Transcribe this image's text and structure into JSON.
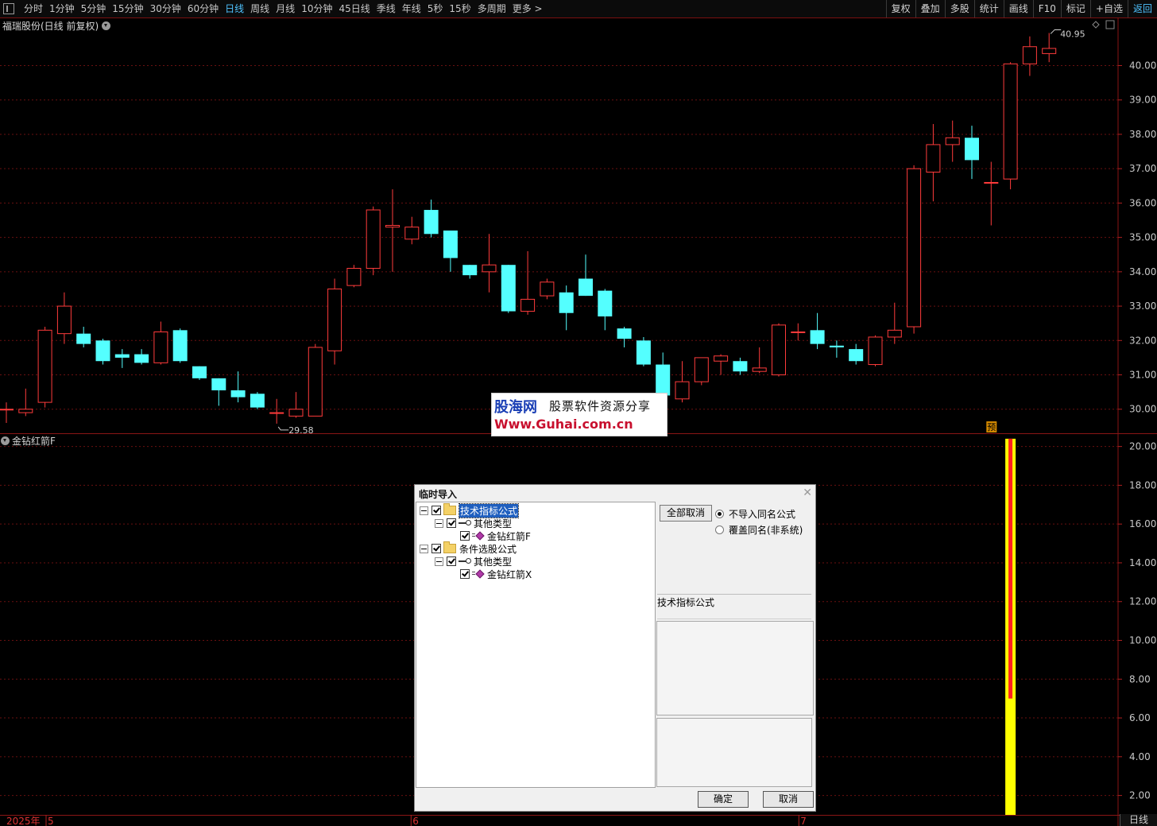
{
  "toolbar": {
    "periods": [
      {
        "label": "分时",
        "active": false
      },
      {
        "label": "1分钟",
        "active": false
      },
      {
        "label": "5分钟",
        "active": false
      },
      {
        "label": "15分钟",
        "active": false
      },
      {
        "label": "30分钟",
        "active": false
      },
      {
        "label": "60分钟",
        "active": false
      },
      {
        "label": "日线",
        "active": true
      },
      {
        "label": "周线",
        "active": false
      },
      {
        "label": "月线",
        "active": false
      },
      {
        "label": "10分钟",
        "active": false
      },
      {
        "label": "45日线",
        "active": false
      },
      {
        "label": "季线",
        "active": false
      },
      {
        "label": "年线",
        "active": false
      },
      {
        "label": "5秒",
        "active": false
      },
      {
        "label": "15秒",
        "active": false
      },
      {
        "label": "多周期",
        "active": false
      },
      {
        "label": "更多 >",
        "active": false
      }
    ],
    "right_buttons": [
      {
        "label": "复权",
        "highlight": false
      },
      {
        "label": "叠加",
        "highlight": false
      },
      {
        "label": "多股",
        "highlight": false
      },
      {
        "label": "统计",
        "highlight": false
      },
      {
        "label": "画线",
        "highlight": false
      },
      {
        "label": "F10",
        "highlight": false
      },
      {
        "label": "标记",
        "highlight": false
      },
      {
        "label": "+自选",
        "highlight": false
      },
      {
        "label": "返回",
        "highlight": true
      }
    ]
  },
  "main_panel": {
    "title": "福瑞股份(日线 前复权)",
    "price_labels": [
      "40.00",
      "39.00",
      "38.00",
      "37.00",
      "36.00",
      "35.00",
      "34.00",
      "33.00",
      "32.00",
      "31.00",
      "30.00"
    ],
    "high_label": "40.95",
    "low_label": "29.58",
    "forecast_badge": "预",
    "colors": {
      "up": "#ff3b3b",
      "down": "#54ffff",
      "grid": "#6a1010"
    }
  },
  "indicator_panel": {
    "title": "金钻红箭F",
    "axis_labels": [
      "20.00",
      "18.00",
      "16.00",
      "14.00",
      "12.00",
      "10.00",
      "8.00",
      "6.00",
      "4.00",
      "2.00"
    ],
    "bar_colors": {
      "yellow": "#ffff00",
      "red": "#ff2020"
    }
  },
  "bottom_axis": {
    "labels": [
      {
        "text": "2025年",
        "month": "5"
      },
      {
        "text": "6"
      },
      {
        "text": "7"
      }
    ],
    "tab_label": "日线"
  },
  "watermark": {
    "logo": "股海网",
    "subtitle": "股票软件资源分享",
    "url": "Www.Guhai.com.cn"
  },
  "dialog": {
    "title": "临时导入",
    "tree": [
      {
        "level": 0,
        "icon": "folder-icon",
        "label": "技术指标公式",
        "checked": true,
        "selected": true
      },
      {
        "level": 1,
        "icon": "key-icon",
        "label": "其他类型",
        "checked": true
      },
      {
        "level": 2,
        "icon": "formula-icon",
        "label": "金钻红箭F",
        "checked": true
      },
      {
        "level": 0,
        "icon": "folder-icon",
        "label": "条件选股公式",
        "checked": true
      },
      {
        "level": 1,
        "icon": "key-icon",
        "label": "其他类型",
        "checked": true
      },
      {
        "level": 2,
        "icon": "formula-icon",
        "label": "金钻红箭X",
        "checked": true
      }
    ],
    "cancel_all_label": "全部取消",
    "radio_options": [
      {
        "label": "不导入同名公式",
        "checked": true
      },
      {
        "label": "覆盖同名(非系统)",
        "checked": false
      }
    ],
    "info_label": "技术指标公式",
    "ok_label": "确定",
    "cancel_label": "取消"
  },
  "chart_data": {
    "type": "candlestick",
    "title": "福瑞股份(日线 前复权)",
    "ylim": [
      29.3,
      41.4
    ],
    "candles": [
      {
        "o": 30.0,
        "h": 30.2,
        "l": 29.6,
        "c": 30.0
      },
      {
        "o": 29.9,
        "h": 30.6,
        "l": 29.8,
        "c": 30.0
      },
      {
        "o": 30.2,
        "h": 32.4,
        "l": 30.05,
        "c": 32.3
      },
      {
        "o": 32.2,
        "h": 33.4,
        "l": 31.9,
        "c": 33.0
      },
      {
        "o": 32.2,
        "h": 32.4,
        "l": 31.8,
        "c": 31.9
      },
      {
        "o": 32.0,
        "h": 32.05,
        "l": 31.3,
        "c": 31.4
      },
      {
        "o": 31.6,
        "h": 31.75,
        "l": 31.2,
        "c": 31.5
      },
      {
        "o": 31.6,
        "h": 31.75,
        "l": 31.3,
        "c": 31.35
      },
      {
        "o": 31.35,
        "h": 32.55,
        "l": 31.3,
        "c": 32.25
      },
      {
        "o": 32.3,
        "h": 32.35,
        "l": 31.35,
        "c": 31.4
      },
      {
        "o": 31.25,
        "h": 31.25,
        "l": 30.85,
        "c": 30.9
      },
      {
        "o": 30.9,
        "h": 30.9,
        "l": 30.1,
        "c": 30.55
      },
      {
        "o": 30.55,
        "h": 31.1,
        "l": 30.2,
        "c": 30.35
      },
      {
        "o": 30.45,
        "h": 30.5,
        "l": 30.0,
        "c": 30.05
      },
      {
        "o": 29.9,
        "h": 30.3,
        "l": 29.58,
        "c": 29.9
      },
      {
        "o": 29.8,
        "h": 30.5,
        "l": 29.75,
        "c": 30.0
      },
      {
        "o": 29.8,
        "h": 31.9,
        "l": 29.8,
        "c": 31.8
      },
      {
        "o": 31.7,
        "h": 33.8,
        "l": 31.3,
        "c": 33.5
      },
      {
        "o": 33.6,
        "h": 34.2,
        "l": 33.55,
        "c": 34.1
      },
      {
        "o": 34.1,
        "h": 35.9,
        "l": 33.9,
        "c": 35.8
      },
      {
        "o": 35.3,
        "h": 36.4,
        "l": 34.0,
        "c": 35.35
      },
      {
        "o": 34.95,
        "h": 35.6,
        "l": 34.8,
        "c": 35.3
      },
      {
        "o": 35.8,
        "h": 36.1,
        "l": 35.0,
        "c": 35.1
      },
      {
        "o": 35.2,
        "h": 35.2,
        "l": 34.0,
        "c": 34.4
      },
      {
        "o": 34.2,
        "h": 34.2,
        "l": 33.8,
        "c": 33.9
      },
      {
        "o": 34.0,
        "h": 35.1,
        "l": 33.4,
        "c": 34.2
      },
      {
        "o": 34.2,
        "h": 34.2,
        "l": 32.8,
        "c": 32.85
      },
      {
        "o": 32.85,
        "h": 34.6,
        "l": 32.75,
        "c": 33.2
      },
      {
        "o": 33.3,
        "h": 33.8,
        "l": 33.2,
        "c": 33.7
      },
      {
        "o": 33.4,
        "h": 33.6,
        "l": 32.3,
        "c": 32.8
      },
      {
        "o": 33.8,
        "h": 34.5,
        "l": 33.3,
        "c": 33.3
      },
      {
        "o": 33.45,
        "h": 33.5,
        "l": 32.3,
        "c": 32.7
      },
      {
        "o": 32.35,
        "h": 32.4,
        "l": 31.8,
        "c": 32.05
      },
      {
        "o": 32.0,
        "h": 32.1,
        "l": 31.25,
        "c": 31.3
      },
      {
        "o": 31.3,
        "h": 31.65,
        "l": 30.3,
        "c": 30.4
      },
      {
        "o": 30.3,
        "h": 31.4,
        "l": 30.2,
        "c": 30.8
      },
      {
        "o": 30.8,
        "h": 31.5,
        "l": 30.7,
        "c": 31.5
      },
      {
        "o": 31.4,
        "h": 31.6,
        "l": 31.0,
        "c": 31.55
      },
      {
        "o": 31.4,
        "h": 31.5,
        "l": 31.0,
        "c": 31.1
      },
      {
        "o": 31.1,
        "h": 31.8,
        "l": 31.05,
        "c": 31.2
      },
      {
        "o": 31.0,
        "h": 32.5,
        "l": 30.95,
        "c": 32.45
      },
      {
        "o": 32.25,
        "h": 32.5,
        "l": 32.0,
        "c": 32.25
      },
      {
        "o": 32.3,
        "h": 32.8,
        "l": 31.75,
        "c": 31.9
      },
      {
        "o": 31.85,
        "h": 32.0,
        "l": 31.5,
        "c": 31.8
      },
      {
        "o": 31.75,
        "h": 31.9,
        "l": 31.3,
        "c": 31.4
      },
      {
        "o": 31.3,
        "h": 32.15,
        "l": 31.25,
        "c": 32.1
      },
      {
        "o": 32.1,
        "h": 33.1,
        "l": 31.9,
        "c": 32.3
      },
      {
        "o": 32.4,
        "h": 37.1,
        "l": 32.2,
        "c": 37.0
      },
      {
        "o": 36.9,
        "h": 38.3,
        "l": 36.05,
        "c": 37.7
      },
      {
        "o": 37.7,
        "h": 38.4,
        "l": 37.2,
        "c": 37.9
      },
      {
        "o": 37.9,
        "h": 38.25,
        "l": 36.7,
        "c": 37.25
      },
      {
        "o": 36.6,
        "h": 37.2,
        "l": 35.35,
        "c": 36.6
      },
      {
        "o": 36.7,
        "h": 40.1,
        "l": 36.4,
        "c": 40.05
      },
      {
        "o": 40.05,
        "h": 40.85,
        "l": 39.7,
        "c": 40.55
      },
      {
        "o": 40.35,
        "h": 40.95,
        "l": 40.1,
        "c": 40.5
      }
    ],
    "indicator": {
      "name": "金钻红箭F",
      "ylim": [
        1.0,
        20.6
      ],
      "bars": [
        {
          "index": 52,
          "color": "yellow",
          "low": 1.0,
          "high": 20.4
        },
        {
          "index": 52,
          "color": "red",
          "low": 7.0,
          "high": 20.4
        }
      ]
    }
  }
}
